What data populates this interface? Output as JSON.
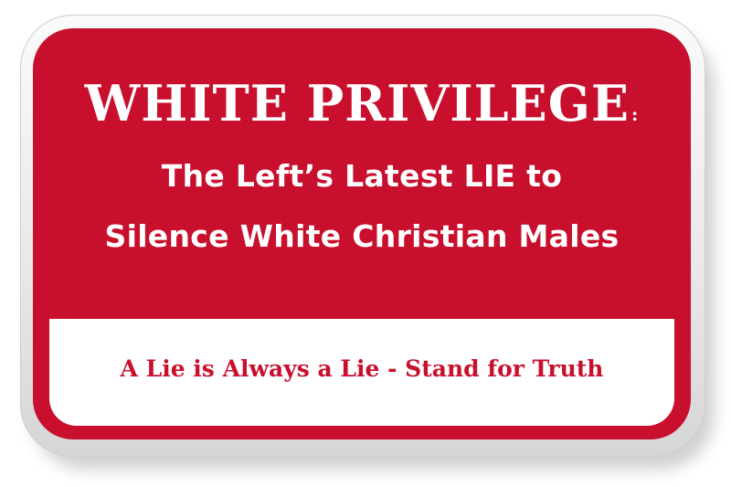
{
  "sign": {
    "headline": "WHITE PRIVILEGE",
    "headline_colon": ":",
    "subtitle_line_1": "The Left’s Latest LIE to",
    "subtitle_line_2": "Silence White Christian Males",
    "banner_text": "A Lie is Always a Lie - Stand for Truth"
  },
  "colors": {
    "sign_red": "#c8102e",
    "text_white": "#ffffff",
    "banner_white": "#ffffff"
  }
}
